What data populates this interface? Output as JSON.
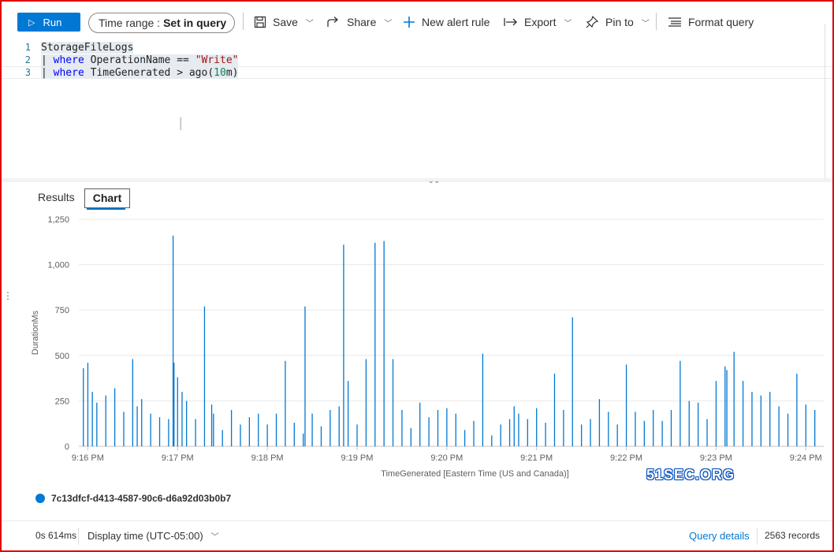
{
  "toolbar": {
    "run_label": "Run",
    "time_range_label": "Time range :",
    "time_range_value": "Set in query",
    "save_label": "Save",
    "share_label": "Share",
    "new_alert_label": "New alert rule",
    "export_label": "Export",
    "pin_label": "Pin to",
    "format_label": "Format query"
  },
  "editor": {
    "line_numbers": [
      "1",
      "2",
      "3"
    ],
    "line1": "StorageFileLogs",
    "line2": {
      "pipe": "| ",
      "kw": "where",
      "mid": " OperationName == ",
      "str": "\"Write\""
    },
    "line3": {
      "pipe": "| ",
      "kw": "where",
      "mid": " TimeGenerated > ago(",
      "num": "10",
      "end": "m)"
    }
  },
  "tabs": {
    "results": "Results",
    "chart": "Chart"
  },
  "chart_data": {
    "type": "bar",
    "title": "",
    "xlabel": "TimeGenerated [Eastern Time (US and Canada)]",
    "ylabel": "DurationMs",
    "ylim": [
      0,
      1250
    ],
    "yticks": [
      "0",
      "250",
      "500",
      "750",
      "1,000",
      "1,250"
    ],
    "ytick_values": [
      0,
      250,
      500,
      750,
      1000,
      1250
    ],
    "xticks": [
      "9:16 PM",
      "9:17 PM",
      "9:18 PM",
      "9:19 PM",
      "9:20 PM",
      "9:21 PM",
      "9:22 PM",
      "9:23 PM",
      "9:24 PM"
    ],
    "xlim_minutes": [
      -0.1,
      8.2
    ],
    "grid": true,
    "series": [
      {
        "name": "7c13dfcf-d413-4587-90c6-d6a92d03b0b7",
        "color": "#0078d4"
      }
    ],
    "x_minutes": [
      -0.05,
      0.0,
      0.05,
      0.1,
      0.2,
      0.3,
      0.4,
      0.5,
      0.55,
      0.6,
      0.7,
      0.8,
      0.9,
      0.95,
      0.96,
      1.0,
      1.05,
      1.1,
      1.2,
      1.3,
      1.38,
      1.4,
      1.5,
      1.6,
      1.7,
      1.8,
      1.9,
      2.0,
      2.1,
      2.2,
      2.3,
      2.4,
      2.42,
      2.5,
      2.6,
      2.7,
      2.8,
      2.85,
      2.9,
      3.0,
      3.1,
      3.2,
      3.3,
      3.4,
      3.5,
      3.6,
      3.7,
      3.8,
      3.9,
      4.0,
      4.1,
      4.2,
      4.3,
      4.4,
      4.5,
      4.6,
      4.7,
      4.75,
      4.8,
      4.9,
      5.0,
      5.1,
      5.2,
      5.3,
      5.4,
      5.5,
      5.6,
      5.7,
      5.8,
      5.9,
      6.0,
      6.1,
      6.2,
      6.3,
      6.4,
      6.5,
      6.6,
      6.7,
      6.8,
      6.9,
      7.0,
      7.1,
      7.12,
      7.2,
      7.3,
      7.4,
      7.5,
      7.6,
      7.7,
      7.8,
      7.9,
      8.0,
      8.1
    ],
    "values": [
      430,
      460,
      300,
      240,
      280,
      320,
      190,
      480,
      220,
      260,
      180,
      160,
      150,
      1160,
      460,
      380,
      300,
      250,
      150,
      770,
      230,
      180,
      90,
      200,
      120,
      160,
      180,
      120,
      180,
      470,
      130,
      70,
      770,
      180,
      110,
      200,
      220,
      1110,
      360,
      120,
      480,
      1120,
      1130,
      480,
      200,
      100,
      240,
      160,
      200,
      210,
      180,
      90,
      140,
      510,
      60,
      120,
      150,
      220,
      180,
      150,
      210,
      130,
      400,
      200,
      710,
      120,
      150,
      260,
      190,
      120,
      450,
      190,
      140,
      200,
      140,
      200,
      470,
      250,
      240,
      150,
      360,
      440,
      420,
      520,
      360,
      300,
      280,
      300,
      220,
      180,
      400,
      230,
      200
    ]
  },
  "legend": {
    "series_name": "7c13dfcf-d413-4587-90c6-d6a92d03b0b7"
  },
  "watermark": "51SEC.ORG",
  "status": {
    "elapsed": "0s 614ms",
    "display_time": "Display time (UTC-05:00)",
    "query_details": "Query details",
    "records": "2563 records"
  }
}
